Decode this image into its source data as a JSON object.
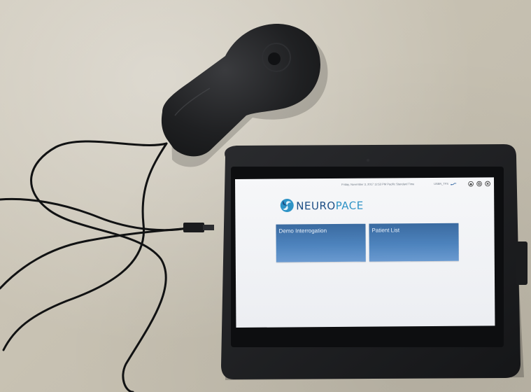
{
  "status_bar": {
    "datetime": "Friday, November 3, 2017 12:53 PM Pacific Standard Time",
    "user": "USER_TFS",
    "icons": [
      "link-icon",
      "home-icon",
      "settings-icon",
      "close-icon"
    ]
  },
  "brand": {
    "name_part1": "NEURO",
    "name_part2": "PACE",
    "logo": "neuropace-logo-icon",
    "colors": {
      "dark_blue": "#1d4e85",
      "light_blue": "#2e93c6"
    }
  },
  "tiles": [
    {
      "label": "Demo Interrogation",
      "color": "#4d83bd"
    },
    {
      "label": "Patient List",
      "color": "#4d83bd"
    }
  ],
  "scene": {
    "surface_color": "#c9c3b4",
    "device_color": "#1e1f21"
  }
}
